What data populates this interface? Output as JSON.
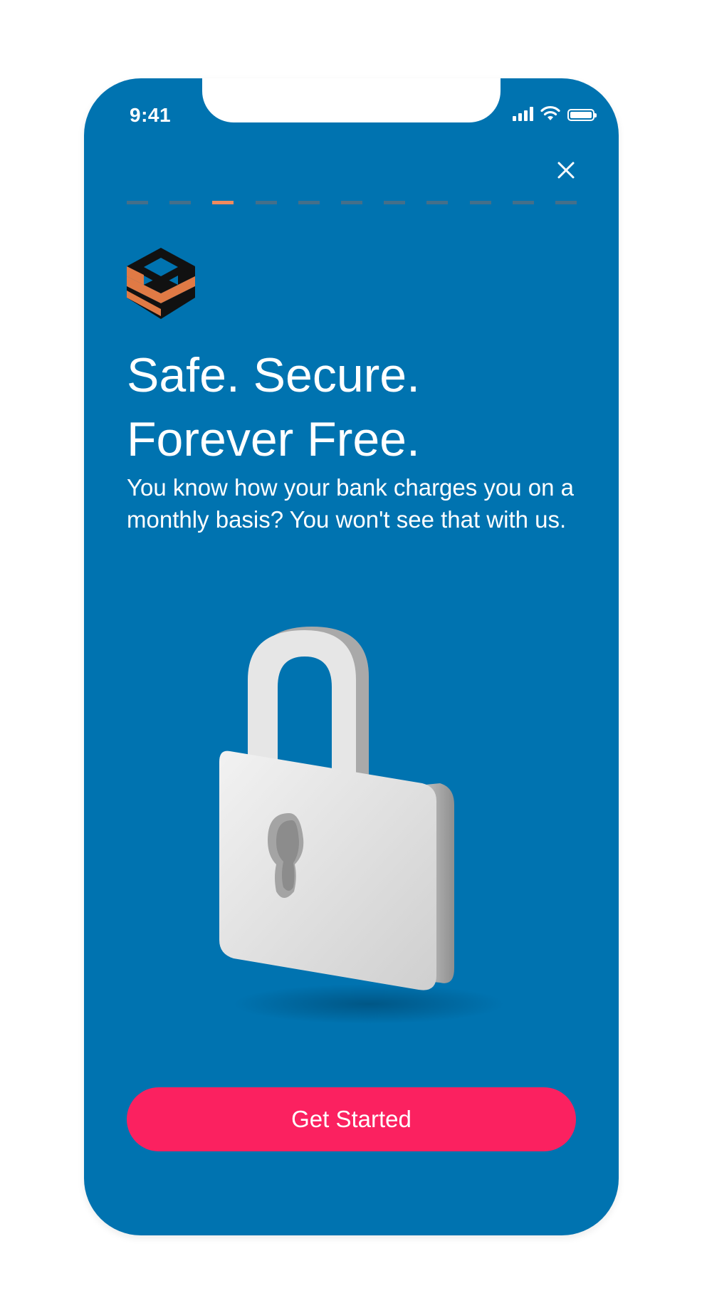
{
  "status_bar": {
    "time": "9:41",
    "icons": [
      "signal-icon",
      "wifi-icon",
      "battery-icon"
    ]
  },
  "header": {
    "close_icon": "close-icon"
  },
  "progress": {
    "total_steps": 11,
    "current_step": 3,
    "active_color": "#f08a5d",
    "inactive_color": "#446f8a"
  },
  "content": {
    "logo_icon": "brand-logo",
    "title_line1": "Safe. Secure.",
    "title_line2": "Forever Free.",
    "body": "You know how your bank charges you on a monthly basis? You won't see that with us.",
    "illustration": "padlock-illustration"
  },
  "cta": {
    "label": "Get Started"
  },
  "colors": {
    "background": "#0073b0",
    "cta": "#fb2160",
    "logo_orange": "#e07a45",
    "logo_black": "#111111"
  }
}
